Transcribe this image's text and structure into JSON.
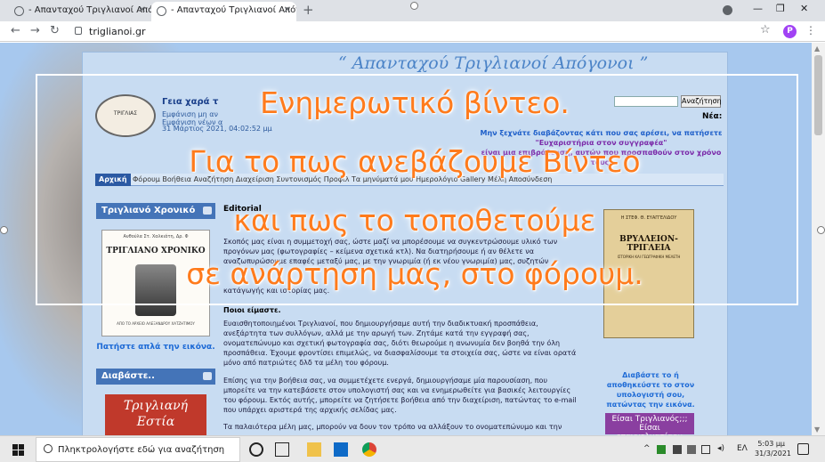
{
  "browser": {
    "tabs": [
      {
        "label": "- Απανταχού Τριγλιανοί Απόγο"
      },
      {
        "label": "- Απανταχού Τριγλιανοί Απόγονο"
      }
    ],
    "url": "triglianoi.gr",
    "profile_initial": "P"
  },
  "site": {
    "title": "“ Απανταχού Τριγλιανοί Απόγονοι ”",
    "logo_text": "ΤΡΙΓΛΙΑΣ",
    "greeting": "Γεια χαρά τ",
    "greeting_sub1": "Εμφάνιση μη αν",
    "greeting_sub2": "Εμφάνιση νέων α",
    "date": "31 Μάρτιος 2021, 04:02:52 μμ",
    "search_button": "Αναζήτηση",
    "news_label": "Νέα:",
    "notice_line1": "Μην ξεχνάτε διαβάζοντας κάτι που σας αρέσει, να πατήσετε",
    "notice_line2": "\"Ευχαριστήρια στον συγγραφέα\"",
    "notice_line3": "είναι μια επιβράβευση, αυτών που προσπαθούν στον χρόνο τους.",
    "menu": {
      "active": "Αρχική",
      "items": "Φόρουμ  Βοήθεια  Αναζήτηση  Διαχείριση  Συντονισμός  Προφίλ  Τα μηνύματά μου  Ημερολόγιο  Gallery  Μέλη  Αποσύνδεση"
    },
    "left_block_title": "Τριγλιανό Χρονικό",
    "book": {
      "author": "Ανθούλα Στ. Χαλκιάτη, Δρ. Φ",
      "title": "ΤΡΙΓΛΙΑΝΟ ΧΡΟΝΙΚΟ",
      "footer": "ΑΠΟ ΤΟ ΑΡΧΕΙΟ ΑΛΕΞΑΝΔΡΟΥ ΧΑΤΖΗΤΙΜΟΥ"
    },
    "left_caption": "Πατήστε απλά την εικόνα.",
    "read_block_title": "Διαβάστε..",
    "estia_line1": "Τριγλιανή",
    "estia_line2": "Εστία",
    "center": {
      "heading": "Editorial",
      "para1_line1": "Σκοπός μας είναι η συμμετοχή σας, ώστε μαζί να μπορέσουμε να συγκεντρώσουμε υλικό των",
      "para1_line2": "προγόνων μας (φωτογραφίες – κείμενα σχετικά κτλ). Να διατηρήσουμε ή αν θέλετε να",
      "para1_line3": "αναζωπυρώσουμε επαφές μεταξύ μας, με την γνωριμία (ή εκ νέου γνωριμία) μας, συζητών",
      "para1_line4": "κατάγωγής και ιστορίας μας.",
      "sub_heading": "Ποιοι είμαστε.",
      "para2_line1": "Ευαισθητοποιημένοι Τριγλιανοί, που δημιουργήσαμε αυτή την διαδικτυακή προσπάθεια,",
      "para2_line2": "ανεξάρτητα των συλλόγων, αλλά με την αρωγή των. Ζητάμε κατά την εγγραφή σας,",
      "para2_line3": "ονοματεπώνυμο και σχετική φωτογραφία σας, διότι θεωρούμε η ανωνυμία δεν βοηθά την όλη",
      "para2_line4": "προσπάθεια. Έχουμε φροντίσει επιμελώς, να διασφαλίσουμε τα στοιχεία σας, ώστε να είναι ορατά",
      "para2_line5": "μόνο από πατριώτες δλδ τα μέλη του φόρουμ.",
      "para3_line1": "Επίσης για την βοήθεια σας, να συμμετέχετε ενεργά, δημιουργήσαμε μία παρουσίαση, που",
      "para3_line2": "μπορείτε να την κατεβάσετε στον υπολογιστή σας και να ενημερωθείτε για βασικές λειτουργίες",
      "para3_line3": "του φόρουμ. Εκτός αυτής, μπορείτε να ζητήσετε βοήθεια από την διαχείριση, πατώντας το e-mail",
      "para3_line4": "που υπάρχει αριστερά της αρχικής σελίδας μας.",
      "para4_line1": "Τα παλαιότερα μέλη μας, μπορούν να δουν τον τρόπο να αλλάξουν το ονοματεπώνυμο και την"
    },
    "right_book": {
      "top": "Η ΣΤΕΦ. Θ. ΕΥΑΓΓΕΛΙΔΟΥ",
      "title": "ΒΡΥΛΛΕΙΟΝ-ΤΡΙΓΛΕΙΑ",
      "sub": "ΙΣΤΟΡΙΚΗ ΚΑΙ ΓΕΩΓΡΑΦΙΚΗ ΜΕΛΕΤΗ"
    },
    "right_caption": "Διαβάστε το ή αποθηκεύστε το στον υπολογιστή σου, πατώντας την εικόνα.",
    "right_banner": "Είσαι Τριγλιανός;;; Είσαι επαγγελματίας;;"
  },
  "overlay": {
    "line1": "Ενημερωτικό βίντεο.",
    "line2": "Για το πως ανεβάζουμε Βίντεο",
    "line3": "και πως το τοποθετούμε",
    "line4": "σε ανάρτηση μας, στο φόρουμ."
  },
  "taskbar": {
    "search_placeholder": "Πληκτρολογήστε εδώ για αναζήτηση",
    "language": "ΕΛ",
    "time": "5:03 μμ",
    "date": "31/3/2021"
  }
}
